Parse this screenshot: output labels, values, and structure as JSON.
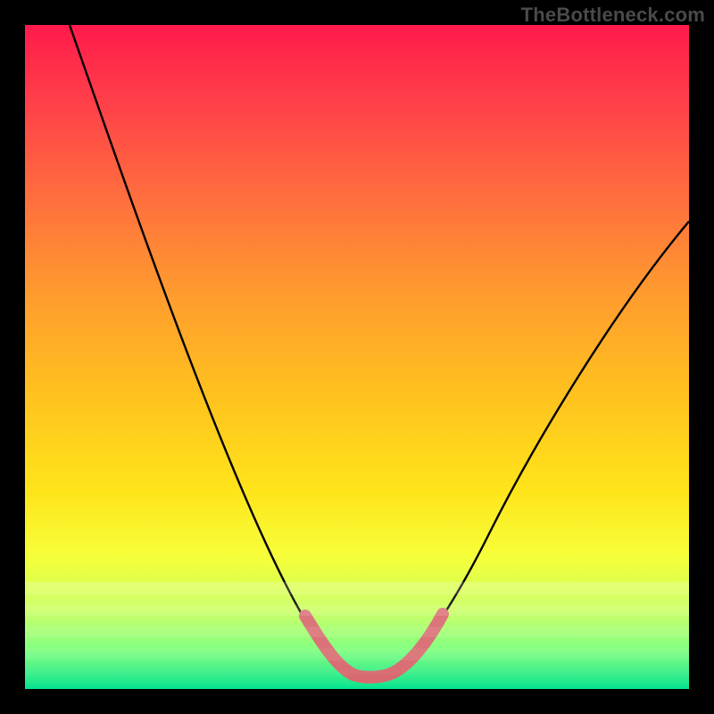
{
  "watermark": {
    "text": "TheBottleneck.com"
  },
  "colors": {
    "frame": "#000000",
    "gradient_top": "#ff1a4b",
    "gradient_bottom": "#00e38f",
    "curve": "#000000",
    "pink_highlight": "#d86a6f",
    "watermark_text": "#4a4a4a"
  },
  "chart_data": {
    "type": "line",
    "title": "",
    "xlabel": "",
    "ylabel": "",
    "xlim": [
      0,
      100
    ],
    "ylim": [
      0,
      100
    ],
    "x": [
      0,
      5,
      10,
      15,
      20,
      25,
      30,
      35,
      40,
      44,
      47,
      50,
      53,
      56,
      60,
      65,
      70,
      75,
      80,
      85,
      90,
      95,
      100
    ],
    "values": [
      100,
      93,
      85,
      77,
      68,
      59,
      50,
      40,
      28,
      15,
      6,
      2,
      0,
      2,
      6,
      15,
      24,
      32,
      40,
      48,
      56,
      63,
      70
    ],
    "series": [
      {
        "name": "bottleneck-curve",
        "x": [
          0,
          5,
          10,
          15,
          20,
          25,
          30,
          35,
          40,
          44,
          47,
          50,
          53,
          56,
          60,
          65,
          70,
          75,
          80,
          85,
          90,
          95,
          100
        ],
        "values": [
          100,
          93,
          85,
          77,
          68,
          59,
          50,
          40,
          28,
          15,
          6,
          2,
          0,
          2,
          6,
          15,
          24,
          32,
          40,
          48,
          56,
          63,
          70
        ]
      }
    ],
    "highlight": {
      "description": "pink stroke near curve minimum",
      "x_range": [
        44,
        60
      ],
      "color": "#d86a6f"
    },
    "legend": false,
    "grid": false
  }
}
